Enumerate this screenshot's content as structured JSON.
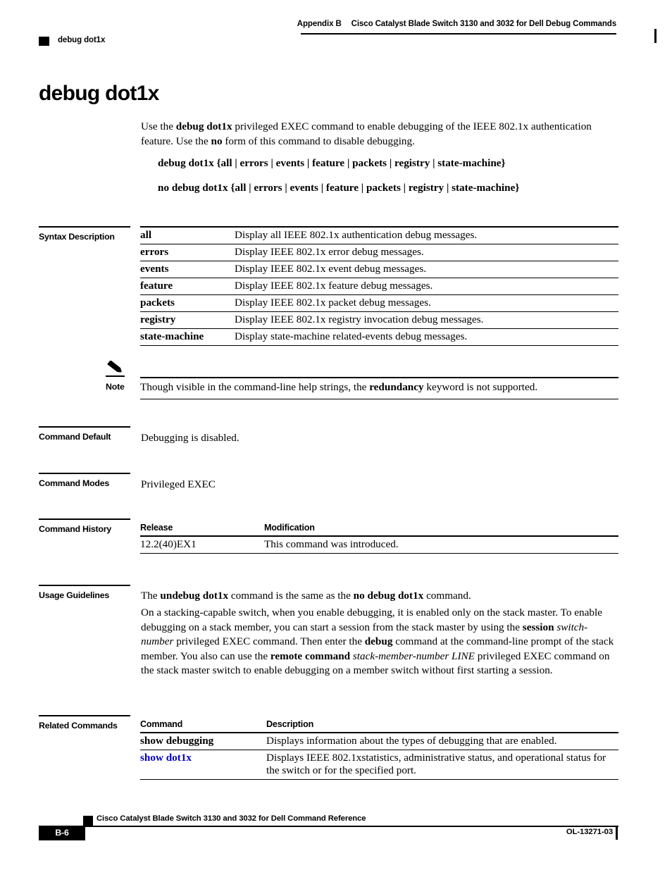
{
  "header": {
    "appendix": "Appendix B",
    "book_title": "Cisco Catalyst Blade Switch 3130 and 3032 for Dell Debug Commands",
    "running_command": "debug dot1x"
  },
  "page_title": "debug dot1x",
  "intro": {
    "part1": "Use the ",
    "bold1": "debug dot1x",
    "part2": " privileged EXEC command to enable debugging of the IEEE 802.1x authentication feature. Use the ",
    "bold2": "no",
    "part3": " form of this command to disable debugging."
  },
  "syntax_lines": {
    "line1": "debug dot1x {all | errors | events | feature | packets | registry | state-machine}",
    "line2": "no debug dot1x {all | errors | events | feature | packets | registry | state-machine}"
  },
  "sections": {
    "syntax_description": "Syntax Description",
    "command_default": "Command Default",
    "command_modes": "Command Modes",
    "command_history": "Command History",
    "usage_guidelines": "Usage Guidelines",
    "related_commands": "Related Commands"
  },
  "syntax_table": {
    "rows": [
      {
        "term": "all",
        "desc": "Display all IEEE 802.1x authentication debug messages."
      },
      {
        "term": "errors",
        "desc": "Display IEEE 802.1x error debug messages."
      },
      {
        "term": "events",
        "desc": "Display IEEE 802.1x event debug messages."
      },
      {
        "term": "feature",
        "desc": "Display IEEE 802.1x feature debug messages."
      },
      {
        "term": "packets",
        "desc": "Display IEEE 802.1x packet debug messages."
      },
      {
        "term": "registry",
        "desc": "Display IEEE 802.1x registry invocation debug messages."
      },
      {
        "term": "state-machine",
        "desc": "Display state-machine related-events debug messages."
      }
    ]
  },
  "note": {
    "label": "Note",
    "icon": "pencil-icon",
    "text_part1": "Though visible in the command-line help strings, the ",
    "text_bold": "redundancy",
    "text_part2": " keyword is not supported."
  },
  "command_default_text": "Debugging is disabled.",
  "command_modes_text": "Privileged EXEC",
  "command_history": {
    "headers": {
      "release": "Release",
      "modification": "Modification"
    },
    "rows": [
      {
        "release": "12.2(40)EX1",
        "modification": "This command was introduced."
      }
    ]
  },
  "usage_guidelines": {
    "p1_a": "The ",
    "p1_b1": "undebug dot1x",
    "p1_b": " command is the same as the ",
    "p1_b2": "no debug dot1x",
    "p1_c": " command.",
    "p2_a": "On a stacking-capable switch, when you enable debugging, it is enabled only on the stack master. To enable debugging on a stack member, you can start a session from the stack master by using the ",
    "p2_b1": "session",
    "p2_i1": "switch-number",
    "p2_b": " privileged EXEC command. Then enter the ",
    "p2_b2": "debug",
    "p2_c": " command at the command-line prompt of the stack member. You also can use the ",
    "p2_b3": "remote command",
    "p2_i2": "stack-member-number LINE",
    "p2_d": " privileged EXEC command on the stack master switch to enable debugging on a member switch without first starting a session."
  },
  "related_commands": {
    "headers": {
      "command": "Command",
      "description": "Description"
    },
    "rows": [
      {
        "command": "show debugging",
        "description": "Displays information about the types of debugging that are enabled.",
        "is_link": false
      },
      {
        "command": "show dot1x",
        "description": "Displays IEEE 802.1xstatistics, administrative status, and operational status for the switch or for the specified port.",
        "is_link": true
      }
    ]
  },
  "footer": {
    "book_title": "Cisco Catalyst Blade Switch 3130 and 3032 for Dell Command Reference",
    "page_number": "B-6",
    "doc_id": "OL-13271-03"
  },
  "colors": {
    "link": "#0000cc",
    "rule": "#000000",
    "background": "#ffffff"
  }
}
